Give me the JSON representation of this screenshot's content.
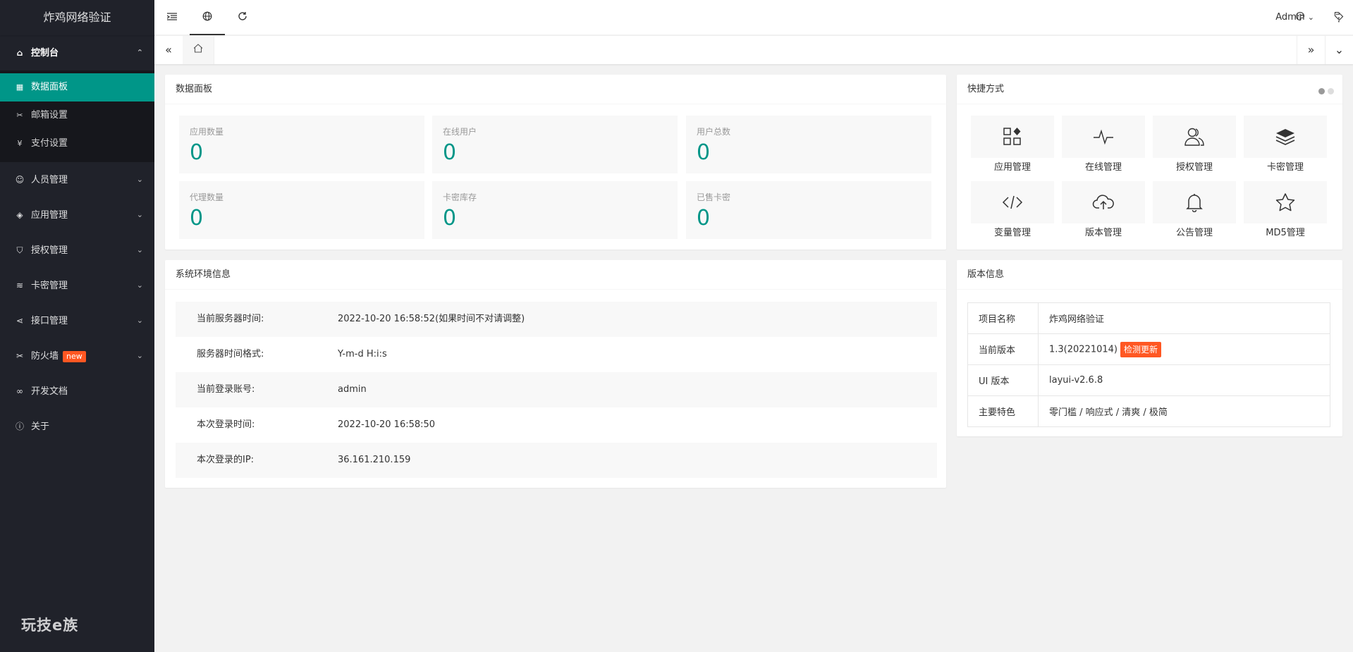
{
  "app": {
    "title": "炸鸡网络验证",
    "footer_logo": "玩技e族"
  },
  "colors": {
    "accent": "#009688",
    "sidebar_bg": "#20222a",
    "danger": "#ff5722"
  },
  "sidebar": {
    "console": {
      "label": "控制台",
      "icon": "home-icon",
      "sub": [
        {
          "label": "数据面板",
          "icon": "windows-icon"
        },
        {
          "label": "邮箱设置",
          "icon": "tools-icon"
        },
        {
          "label": "支付设置",
          "icon": "yen-icon"
        }
      ]
    },
    "items": [
      {
        "label": "人员管理",
        "icon": "user-icon"
      },
      {
        "label": "应用管理",
        "icon": "cube-icon"
      },
      {
        "label": "授权管理",
        "icon": "shield-icon"
      },
      {
        "label": "卡密管理",
        "icon": "layers-icon"
      },
      {
        "label": "接口管理",
        "icon": "share-icon"
      },
      {
        "label": "防火墙",
        "icon": "tools-icon",
        "badge": "new"
      },
      {
        "label": "开发文档",
        "icon": "binoculars-icon"
      },
      {
        "label": "关于",
        "icon": "info-icon"
      }
    ]
  },
  "header": {
    "user": "Admin"
  },
  "dashboard": {
    "title": "数据面板",
    "stats": [
      {
        "label": "应用数量",
        "value": "0"
      },
      {
        "label": "在线用户",
        "value": "0"
      },
      {
        "label": "用户总数",
        "value": "0"
      },
      {
        "label": "代理数量",
        "value": "0"
      },
      {
        "label": "卡密库存",
        "value": "0"
      },
      {
        "label": "已售卡密",
        "value": "0"
      }
    ]
  },
  "shortcuts": {
    "title": "快捷方式",
    "items": [
      {
        "label": "应用管理",
        "icon": "apps-icon"
      },
      {
        "label": "在线管理",
        "icon": "pulse-icon"
      },
      {
        "label": "授权管理",
        "icon": "users-icon"
      },
      {
        "label": "卡密管理",
        "icon": "layers-icon"
      },
      {
        "label": "变量管理",
        "icon": "code-icon"
      },
      {
        "label": "版本管理",
        "icon": "cloud-upload-icon"
      },
      {
        "label": "公告管理",
        "icon": "bell-icon"
      },
      {
        "label": "MD5管理",
        "icon": "star-icon"
      }
    ]
  },
  "env": {
    "title": "系统环境信息",
    "rows": [
      {
        "k": "当前服务器时间:",
        "v": "2022-10-20 16:58:52(如果时间不对请调整)"
      },
      {
        "k": "服务器时间格式:",
        "v": "Y-m-d H:i:s"
      },
      {
        "k": "当前登录账号:",
        "v": "admin"
      },
      {
        "k": "本次登录时间:",
        "v": "2022-10-20 16:58:50"
      },
      {
        "k": "本次登录的IP:",
        "v": "36.161.210.159"
      }
    ]
  },
  "version": {
    "title": "版本信息",
    "rows": [
      {
        "k": "项目名称",
        "v": "炸鸡网络验证"
      },
      {
        "k": "当前版本",
        "v": "1.3(20221014)",
        "tag": "检测更新"
      },
      {
        "k": "UI 版本",
        "v": "layui-v2.6.8"
      },
      {
        "k": "主要特色",
        "v": "零门槛 / 响应式 / 清爽 / 极简"
      }
    ]
  }
}
